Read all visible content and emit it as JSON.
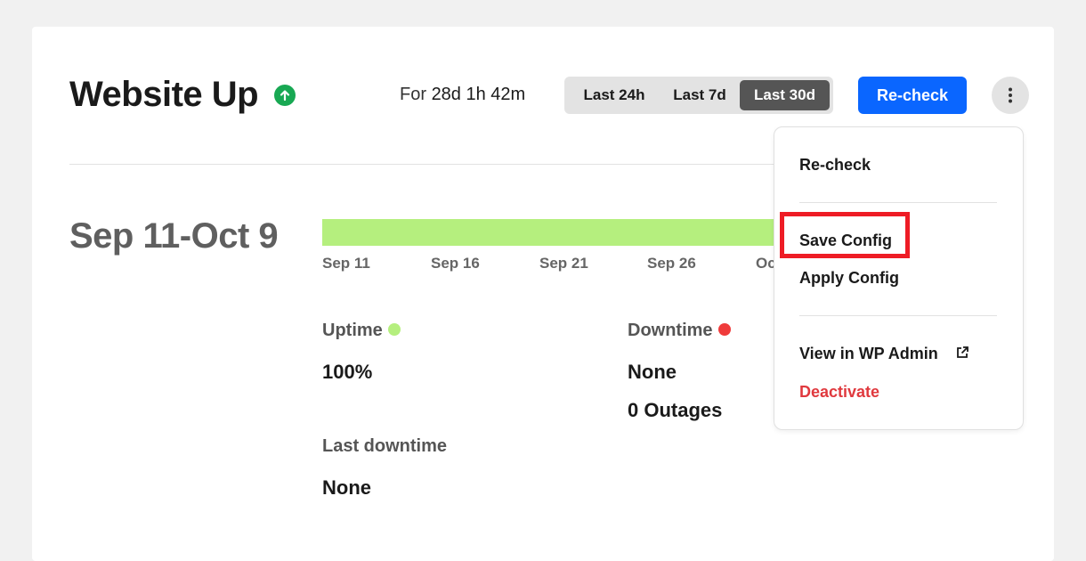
{
  "header": {
    "title": "Website Up",
    "status_icon": "arrow-up-icon",
    "for_prefix": "For",
    "duration": "28d 1h 42m"
  },
  "range_tabs": [
    {
      "label": "Last 24h",
      "active": false
    },
    {
      "label": "Last 7d",
      "active": false
    },
    {
      "label": "Last 30d",
      "active": true
    }
  ],
  "toolbar": {
    "recheck_label": "Re-check",
    "more_icon": "kebab-icon"
  },
  "period": {
    "title": "Sep 11-Oct 9",
    "uptime_fraction": 1.0,
    "ticks": [
      "Sep 11",
      "Sep 16",
      "Sep 21",
      "Sep 26",
      "Oc"
    ]
  },
  "stats": {
    "uptime_label": "Uptime",
    "uptime_value": "100%",
    "downtime_label": "Downtime",
    "downtime_value": "None",
    "outages_value": "0 Outages",
    "last_downtime_label": "Last downtime",
    "last_downtime_value": "None"
  },
  "menu": {
    "items": {
      "recheck": "Re-check",
      "save_config": "Save Config",
      "apply_config": "Apply Config",
      "view_wp_admin": "View in WP Admin",
      "deactivate": "Deactivate"
    },
    "external_icon": "external-link-icon"
  },
  "colors": {
    "primary": "#0a66ff",
    "status_up": "#18a853",
    "uptime_bar": "#b5ef7e",
    "uptime_dot": "#b5ef7e",
    "downtime_dot": "#ef3b3b",
    "deactivate": "#e0393e",
    "highlight": "#ee1c25"
  }
}
